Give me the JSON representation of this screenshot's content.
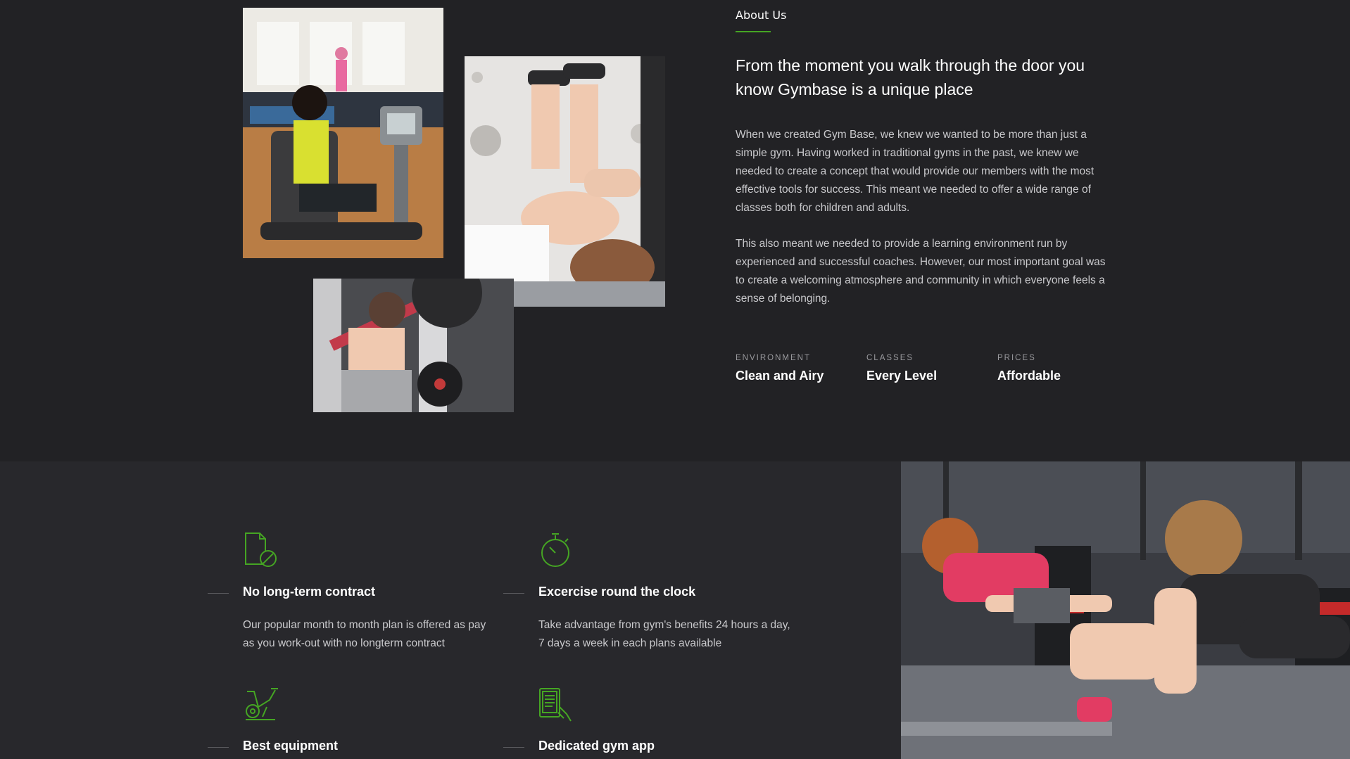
{
  "about": {
    "eyebrow": "About Us",
    "headline": "From the moment you walk through the door you know Gymbase is a unique place",
    "paragraphs": [
      "When we created Gym Base, we knew we wanted to be more than just a simple gym. Having worked in traditional gyms in the past, we knew we needed to create a concept that would provide our members with the most effective tools for success. This meant we needed to offer a wide range of classes both for children and adults.",
      "This also meant we needed to provide a learning environment run by experienced and successful coaches. However, our most important goal was to create a welcoming atmosphere and community in which everyone feels a sense of belonging."
    ],
    "stats": [
      {
        "label": "ENVIRONMENT",
        "value": "Clean and Airy"
      },
      {
        "label": "CLASSES",
        "value": "Every Level"
      },
      {
        "label": "PRICES",
        "value": "Affordable"
      }
    ]
  },
  "features": [
    {
      "icon": "no-contract-icon",
      "title": "No long-term contract",
      "description": "Our popular month to month plan is offered as pay as you work-out with no longterm contract"
    },
    {
      "icon": "stopwatch-icon",
      "title": "Excercise round the clock",
      "description": "Take advantage from gym's benefits 24 hours a day, 7 days a week in each plans available"
    },
    {
      "icon": "exercise-bike-icon",
      "title": "Best equipment",
      "description": ""
    },
    {
      "icon": "gym-app-icon",
      "title": "Dedicated gym app",
      "description": ""
    }
  ],
  "colors": {
    "background": "#222225",
    "band_background": "#28282c",
    "accent": "#45a523",
    "body_text": "#c9c9cc"
  }
}
